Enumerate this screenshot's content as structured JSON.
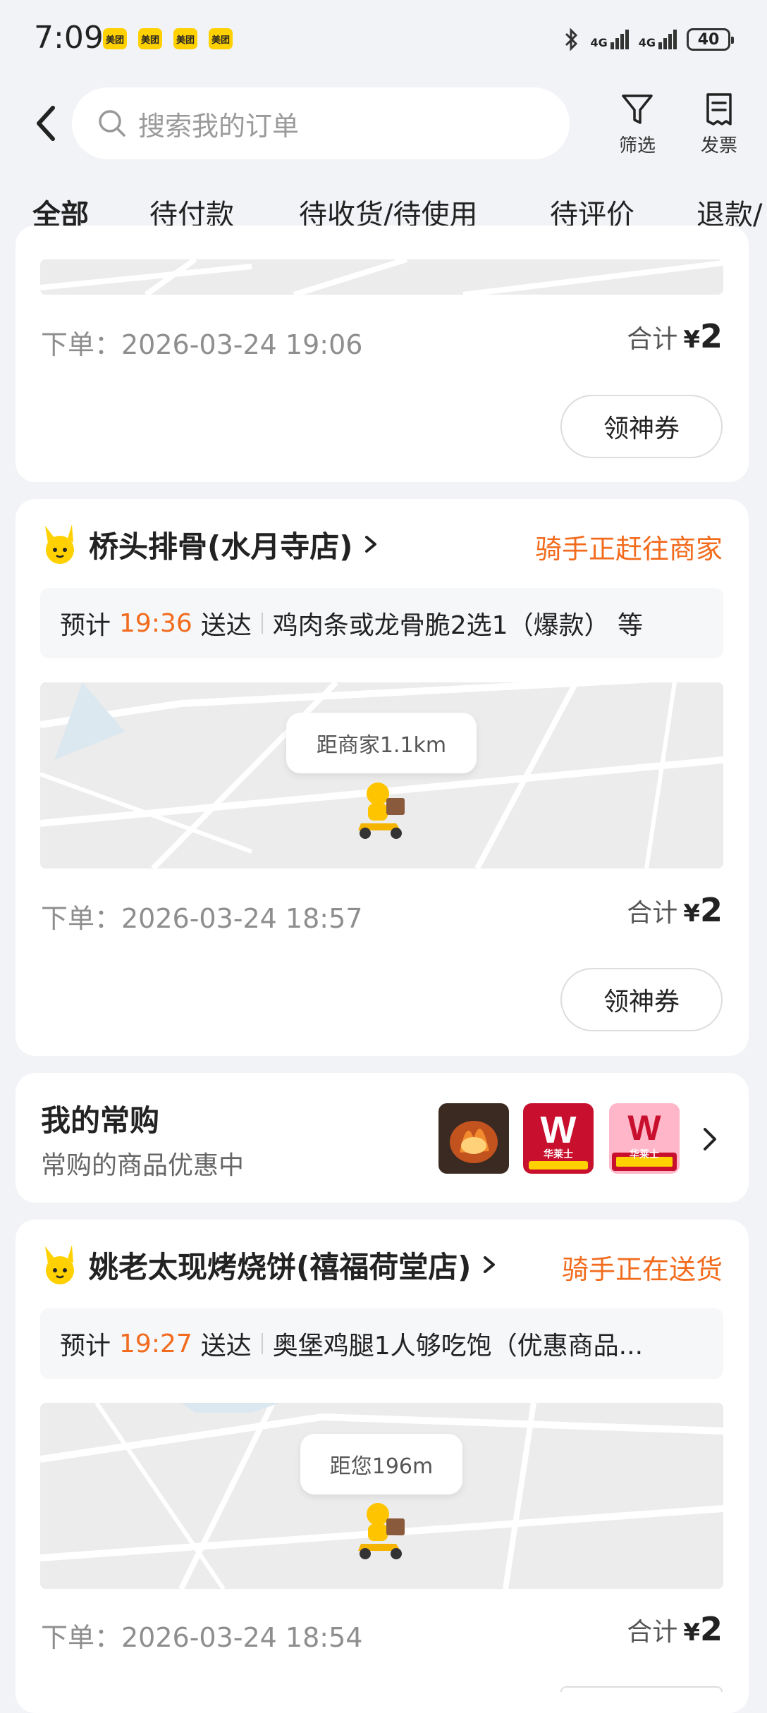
{
  "status_bar": {
    "time": "7:09",
    "badges": [
      "美团",
      "美团",
      "美团",
      "美团"
    ],
    "signal_1": "4G",
    "signal_2": "4G",
    "battery": "40"
  },
  "header": {
    "search_placeholder": "搜索我的订单",
    "filter_label": "筛选",
    "invoice_label": "发票"
  },
  "tabs": [
    {
      "label": "全部",
      "active": true
    },
    {
      "label": "待付款",
      "active": false
    },
    {
      "label": "待收货/待使用",
      "active": false
    },
    {
      "label": "待评价",
      "active": false
    },
    {
      "label": "退款/",
      "active": false
    }
  ],
  "colors": {
    "accent_yellow": "#ffd100",
    "status_orange": "#f26b1d",
    "page_bg": "#f2f3f7"
  },
  "orders": [
    {
      "order_time": "下单：2026-03-24 19:06",
      "total_label": "合计",
      "currency": "¥",
      "total": "2",
      "coupon_button": "领神券"
    },
    {
      "store": "桥头排骨(水月寺店)",
      "status": "骑手正赶往商家",
      "eta_prefix": "预计",
      "eta_time": "19:36",
      "eta_suffix": "送达",
      "items": "鸡肉条或龙骨脆2选1（爆款） 等",
      "distance": "距商家1.1km",
      "order_time": "下单：2026-03-24 18:57",
      "total_label": "合计",
      "currency": "¥",
      "total": "2",
      "coupon_button": "领神券"
    },
    {
      "store": "姚老太现烤烧饼(禧福荷堂店)",
      "status": "骑手正在送货",
      "eta_prefix": "预计",
      "eta_time": "19:27",
      "eta_suffix": "送达",
      "items": "奥堡鸡腿1人够吃饱（优惠商品...",
      "distance": "距您196m",
      "order_time": "下单：2026-03-24 18:54",
      "total_label": "合计",
      "currency": "¥",
      "total": "2"
    }
  ],
  "frequent_buys": {
    "title": "我的常购",
    "subtitle": "常购的商品优惠中",
    "thumbnails": [
      {
        "icon": "grilled-food-thumb"
      },
      {
        "icon": "wallace-logo-thumb",
        "text": "华莱士"
      },
      {
        "icon": "wallace-promo-thumb",
        "text": "华莱士"
      }
    ]
  }
}
